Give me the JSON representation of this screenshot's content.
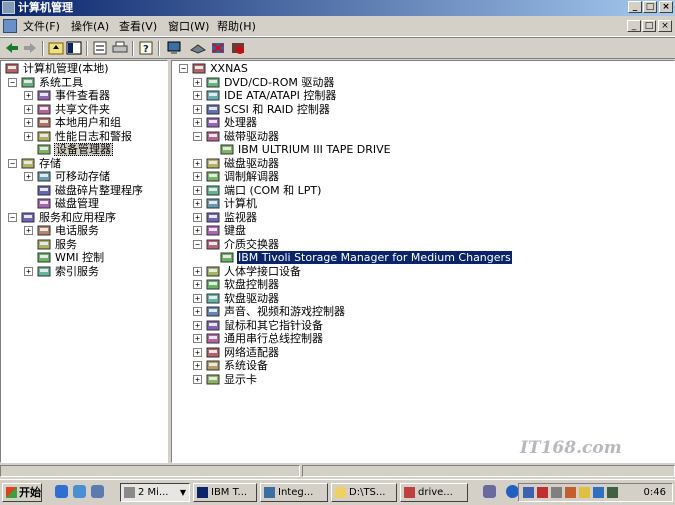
{
  "window": {
    "title": "计算机管理"
  },
  "menu": [
    {
      "label": "文件(F)"
    },
    {
      "label": "操作(A)"
    },
    {
      "label": "查看(V)"
    },
    {
      "label": "窗口(W)"
    },
    {
      "label": "帮助(H)"
    }
  ],
  "window_controls": {
    "minimize": "_",
    "maximize": "□",
    "close": "×"
  },
  "toolbar_icons": [
    "back-icon",
    "forward-icon",
    "up-icon",
    "show-tree-icon",
    "properties-icon",
    "print-icon",
    "help-icon",
    "monitor-icon",
    "scan-hardware-icon",
    "uninstall-icon",
    "disable-device-icon"
  ],
  "left_tree": [
    {
      "label": "计算机管理(本地)",
      "level": 0,
      "expander": "",
      "icon": "computer-mgmt-icon"
    },
    {
      "label": "系统工具",
      "level": 1,
      "expander": "-",
      "icon": "tools-icon"
    },
    {
      "label": "事件查看器",
      "level": 2,
      "expander": "+",
      "icon": "event-viewer-icon"
    },
    {
      "label": "共享文件夹",
      "level": 2,
      "expander": "+",
      "icon": "shared-folder-icon"
    },
    {
      "label": "本地用户和组",
      "level": 2,
      "expander": "+",
      "icon": "users-icon"
    },
    {
      "label": "性能日志和警报",
      "level": 2,
      "expander": "+",
      "icon": "performance-icon"
    },
    {
      "label": "设备管理器",
      "level": 2,
      "expander": "",
      "icon": "device-manager-icon",
      "state": "focus"
    },
    {
      "label": "存储",
      "level": 1,
      "expander": "-",
      "icon": "storage-icon"
    },
    {
      "label": "可移动存储",
      "level": 2,
      "expander": "+",
      "icon": "removable-storage-icon"
    },
    {
      "label": "磁盘碎片整理程序",
      "level": 2,
      "expander": "",
      "icon": "defrag-icon"
    },
    {
      "label": "磁盘管理",
      "level": 2,
      "expander": "",
      "icon": "disk-mgmt-icon"
    },
    {
      "label": "服务和应用程序",
      "level": 1,
      "expander": "-",
      "icon": "services-apps-icon"
    },
    {
      "label": "电话服务",
      "level": 2,
      "expander": "+",
      "icon": "telephony-icon"
    },
    {
      "label": "服务",
      "level": 2,
      "expander": "",
      "icon": "services-icon"
    },
    {
      "label": "WMI 控制",
      "level": 2,
      "expander": "",
      "icon": "wmi-icon"
    },
    {
      "label": "索引服务",
      "level": 2,
      "expander": "+",
      "icon": "indexing-icon"
    }
  ],
  "right_tree": [
    {
      "label": "XXNAS",
      "level": 0,
      "expander": "-",
      "icon": "computer-icon"
    },
    {
      "label": "DVD/CD-ROM 驱动器",
      "level": 1,
      "expander": "+",
      "icon": "cdrom-icon"
    },
    {
      "label": "IDE ATA/ATAPI 控制器",
      "level": 1,
      "expander": "+",
      "icon": "ide-icon"
    },
    {
      "label": "SCSI 和 RAID 控制器",
      "level": 1,
      "expander": "+",
      "icon": "scsi-icon"
    },
    {
      "label": "处理器",
      "level": 1,
      "expander": "+",
      "icon": "cpu-icon"
    },
    {
      "label": "磁带驱动器",
      "level": 1,
      "expander": "-",
      "icon": "tape-drive-icon"
    },
    {
      "label": "IBM ULTRIUM III TAPE DRIVE",
      "level": 2,
      "expander": "",
      "icon": "tape-drive-icon"
    },
    {
      "label": "磁盘驱动器",
      "level": 1,
      "expander": "+",
      "icon": "disk-drive-icon"
    },
    {
      "label": "调制解调器",
      "level": 1,
      "expander": "+",
      "icon": "modem-icon"
    },
    {
      "label": "端口 (COM 和 LPT)",
      "level": 1,
      "expander": "+",
      "icon": "port-icon"
    },
    {
      "label": "计算机",
      "level": 1,
      "expander": "+",
      "icon": "computer-icon"
    },
    {
      "label": "监视器",
      "level": 1,
      "expander": "+",
      "icon": "monitor-icon"
    },
    {
      "label": "键盘",
      "level": 1,
      "expander": "+",
      "icon": "keyboard-icon"
    },
    {
      "label": "介质交换器",
      "level": 1,
      "expander": "-",
      "icon": "media-changer-icon"
    },
    {
      "label": "IBM Tivoli Storage Manager for Medium Changers",
      "level": 2,
      "expander": "",
      "icon": "media-changer-icon",
      "state": "selected"
    },
    {
      "label": "人体学接口设备",
      "level": 1,
      "expander": "+",
      "icon": "hid-icon"
    },
    {
      "label": "软盘控制器",
      "level": 1,
      "expander": "+",
      "icon": "floppy-controller-icon"
    },
    {
      "label": "软盘驱动器",
      "level": 1,
      "expander": "+",
      "icon": "floppy-drive-icon"
    },
    {
      "label": "声音、视频和游戏控制器",
      "level": 1,
      "expander": "+",
      "icon": "sound-icon"
    },
    {
      "label": "鼠标和其它指针设备",
      "level": 1,
      "expander": "+",
      "icon": "mouse-icon"
    },
    {
      "label": "通用串行总线控制器",
      "level": 1,
      "expander": "+",
      "icon": "usb-icon"
    },
    {
      "label": "网络适配器",
      "level": 1,
      "expander": "+",
      "icon": "network-adapter-icon"
    },
    {
      "label": "系统设备",
      "level": 1,
      "expander": "+",
      "icon": "system-device-icon"
    },
    {
      "label": "显示卡",
      "level": 1,
      "expander": "+",
      "icon": "display-adapter-icon"
    }
  ],
  "taskbar": {
    "start_label": "开始",
    "quick_launch": [
      "ie-icon",
      "outlook-icon",
      "show-desktop-icon"
    ],
    "tasks": [
      {
        "label": "2 Mi...",
        "icon": "group-icon",
        "active": true
      },
      {
        "label": "IBM T...",
        "icon": "app-icon"
      },
      {
        "label": "Integ...",
        "icon": "app-icon"
      },
      {
        "label": "D:\\TS...",
        "icon": "folder-icon"
      },
      {
        "label": "drive...",
        "icon": "app-icon"
      }
    ],
    "clock": "0:46"
  },
  "watermark": "IT168.com",
  "colors": {
    "selection": "#0a246a",
    "titlebar": "#0a246a",
    "face": "#d4d0c8"
  }
}
